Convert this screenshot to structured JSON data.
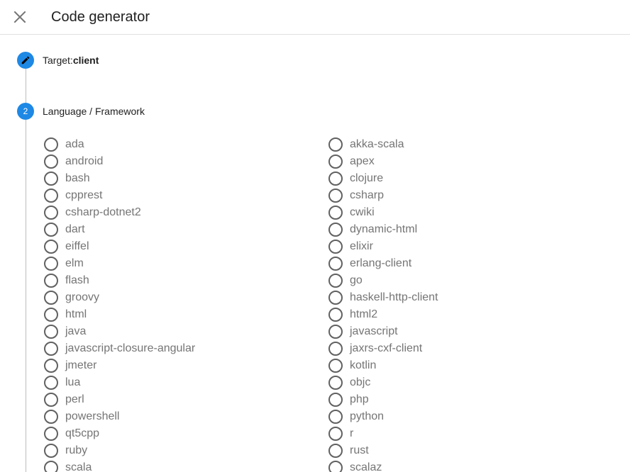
{
  "header": {
    "title": "Code generator",
    "close_icon": "close-icon"
  },
  "steps": {
    "target": {
      "label": "Target:",
      "value": "client",
      "icon": "pencil-icon"
    },
    "language": {
      "number": "2",
      "label": "Language / Framework"
    }
  },
  "languages": {
    "left": [
      "ada",
      "android",
      "bash",
      "cpprest",
      "csharp-dotnet2",
      "dart",
      "eiffel",
      "elm",
      "flash",
      "groovy",
      "html",
      "java",
      "javascript-closure-angular",
      "jmeter",
      "lua",
      "perl",
      "powershell",
      "qt5cpp",
      "ruby",
      "scala"
    ],
    "right": [
      "akka-scala",
      "apex",
      "clojure",
      "csharp",
      "cwiki",
      "dynamic-html",
      "elixir",
      "erlang-client",
      "go",
      "haskell-http-client",
      "html2",
      "javascript",
      "jaxrs-cxf-client",
      "kotlin",
      "objc",
      "php",
      "python",
      "r",
      "rust",
      "scalaz"
    ]
  },
  "colors": {
    "accent": "#1e88e5",
    "radio_border": "#616161",
    "option_text": "#757575",
    "divider": "#e0e0e0"
  }
}
